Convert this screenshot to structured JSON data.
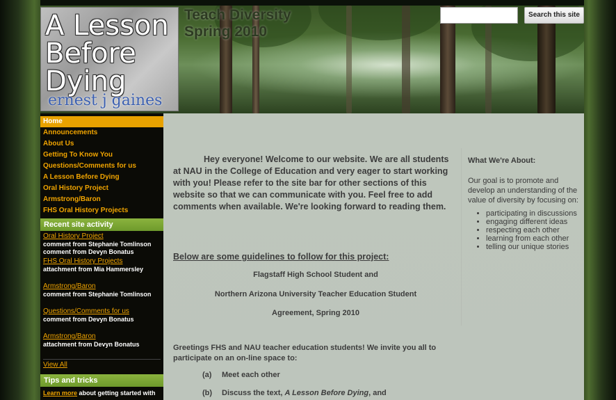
{
  "site": {
    "title_line1": "Teach Diversity",
    "title_line2": "Spring 2010",
    "logo_line1": "A Lesson",
    "logo_line2": "Before",
    "logo_line3": "Dying",
    "logo_author": "ernest j gaines"
  },
  "search": {
    "placeholder": "",
    "button_label": "Search this site"
  },
  "nav": {
    "items": [
      {
        "label": "Home"
      },
      {
        "label": "Announcements"
      },
      {
        "label": "About Us"
      },
      {
        "label": "Getting To Know You"
      },
      {
        "label": "Questions/Comments for us"
      },
      {
        "label": "A Lesson Before Dying"
      },
      {
        "label": "Oral History Project"
      },
      {
        "label": "Armstrong/Baron"
      },
      {
        "label": "FHS Oral History Projects"
      }
    ]
  },
  "recent_activity": {
    "header": "Recent site activity",
    "entries": [
      {
        "link": "Oral History Project",
        "text": "comment from Stephanie Tomlinson",
        "text2": "comment from Devyn Bonatus"
      },
      {
        "link": "FHS Oral History Projects",
        "text": "attachment from Mia Hammersley",
        "text2": ""
      },
      {
        "link": "Armstrong/Baron",
        "text": "comment from Stephanie Tomlinson",
        "text2": ""
      },
      {
        "link": "Questions/Comments for us",
        "text": "comment from Devyn Bonatus",
        "text2": ""
      },
      {
        "link": "Armstrong/Baron",
        "text": "attachment from Devyn Bonatus",
        "text2": ""
      }
    ],
    "view_all": "View All"
  },
  "tips": {
    "header": "Tips and tricks",
    "learn_more": "Learn more",
    "text": " about getting started with"
  },
  "main": {
    "intro": "Hey everyone!  Welcome to our website.  We are all students at NAU in the College of Education and very eager to start working with you!  Please refer to the site bar for other sections of this website so that we can communicate with you.  Feel free to add comments when available.  We're looking forward to reading them.",
    "guidelines_heading": "Below are some guidelines to follow for this project: ",
    "agreement_line1": "Flagstaff High School Student and",
    "agreement_line2": "Northern Arizona University Teacher Education Student",
    "agreement_line3": "Agreement, Spring 2010",
    "greetings": "Greetings FHS and NAU teacher education students! We invite you all to participate on an on-line space to:",
    "list": [
      {
        "marker": "(a)",
        "text": "Meet each other"
      },
      {
        "marker": "(b)",
        "text_prefix": "Discuss the text, ",
        "text_italic": "A Lesson Before Dying",
        "text_suffix": ", and"
      }
    ]
  },
  "about": {
    "title": "What We're About:",
    "body": "Our goal is to promote and develop an understanding of the value of diversity by focusing on:",
    "items": [
      "participating in discussions",
      "engaging different ideas",
      "respecting each other",
      "learning from each other",
      "telling our unique stories"
    ]
  }
}
